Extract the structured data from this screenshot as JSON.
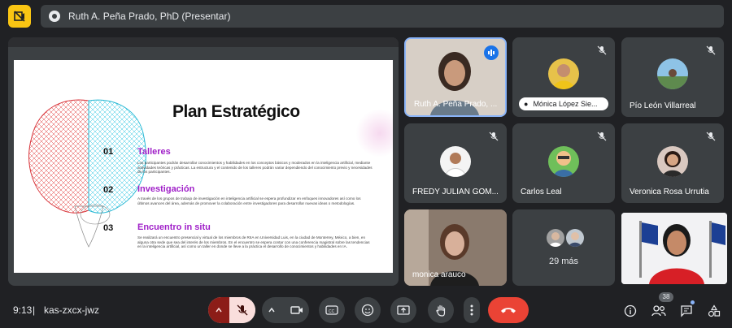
{
  "presenter_banner": {
    "text": "Ruth A. Peña Prado, PhD (Presentar)"
  },
  "slide": {
    "title": "Plan Estratégico",
    "sections": [
      {
        "number": "01",
        "heading": "Talleres",
        "text": "Los participantes podrán desarrollar conocimientos y habilidades en los conceptos básicos y moderados en la inteligencia artificial, mediante actividades teóricas y prácticas. La estructura y el contenido de los talleres podrán variar dependiendo del conocimiento previo y necesidades de los participantes."
      },
      {
        "number": "02",
        "heading": "Investigación",
        "text": "A través de los grupos de trabajo de investigación en inteligencia artificial se espera profundizar en enfoques innovadores así como los últimos avances del área, además de promover la colaboración entre investigadores para desarrollar nuevas ideas o metodologías."
      },
      {
        "number": "03",
        "heading": "Encuentro in situ",
        "text": "Se realizará un encuentro presencial y virtual de los miembros de RIIA en Universidad Luis, en la ciudad de Monterrey, México, a bien, en alguna otra sede que sea del interés de los miembros. En el encuentro se espera contar con una conferencia magistral sobre las tendencias en la inteligencia artificial, así como un taller en donde se lleve a la práctica el desarrollo de conocimientos y habilidades en IA."
      }
    ]
  },
  "participants": [
    {
      "name": "Ruth A. Peña Prado, ...",
      "speaking": true
    },
    {
      "name": "Mónica López Sie...",
      "muted": true,
      "pinned_label": true
    },
    {
      "name": "Pío León Villarreal",
      "muted": true
    },
    {
      "name": "FREDY JULIAN GOM...",
      "muted": true
    },
    {
      "name": "Carlos Leal",
      "muted": true
    },
    {
      "name": "Veronica Rosa Urrutia",
      "muted": true
    },
    {
      "name": "monica arauco"
    },
    {
      "name": "29 más"
    }
  ],
  "bottom": {
    "time": "9:13",
    "meeting_code": "kas-zxcx-jwz",
    "participant_count": "38"
  },
  "colors": {
    "background": "#202124",
    "tile": "#3c4043",
    "speaking_border": "#8ab4f8",
    "end_call": "#ea4335",
    "mic_off_bg": "#f9dedc",
    "record_badge": "#f9c513",
    "slide_heading": "#a020c8"
  }
}
